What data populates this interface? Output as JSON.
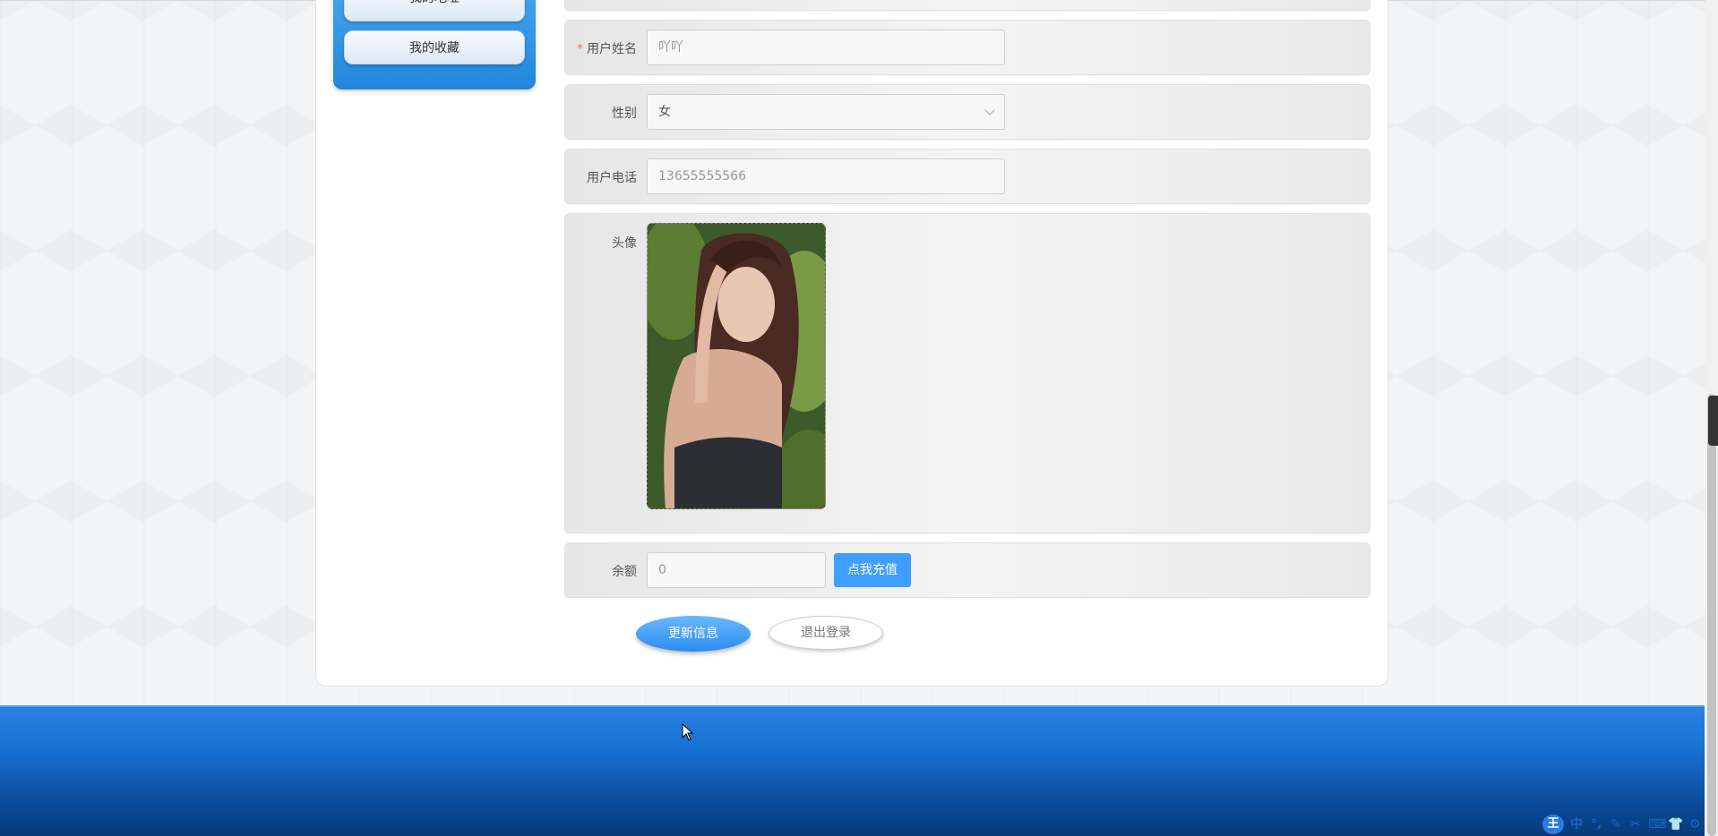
{
  "sidebar": {
    "items": [
      {
        "label": "我的地址"
      },
      {
        "label": "我的收藏"
      }
    ]
  },
  "form": {
    "username": {
      "label": "用户姓名",
      "required_mark": "*",
      "value": "吖吖"
    },
    "gender": {
      "label": "性别",
      "value": "女"
    },
    "phone": {
      "label": "用户电话",
      "value": "13655555566"
    },
    "avatar": {
      "label": "头像"
    },
    "balance": {
      "label": "余额",
      "value": "0",
      "recharge_label": "点我充值"
    }
  },
  "actions": {
    "update_label": "更新信息",
    "logout_label": "退出登录"
  },
  "ime": {
    "logo": "王",
    "items": [
      "中",
      "°,",
      "✎",
      "✂",
      "⌨",
      "👕",
      "⚙"
    ]
  },
  "colors": {
    "primary": "#409eff",
    "required": "#f56c6c",
    "footer": "#1a6fd4"
  }
}
